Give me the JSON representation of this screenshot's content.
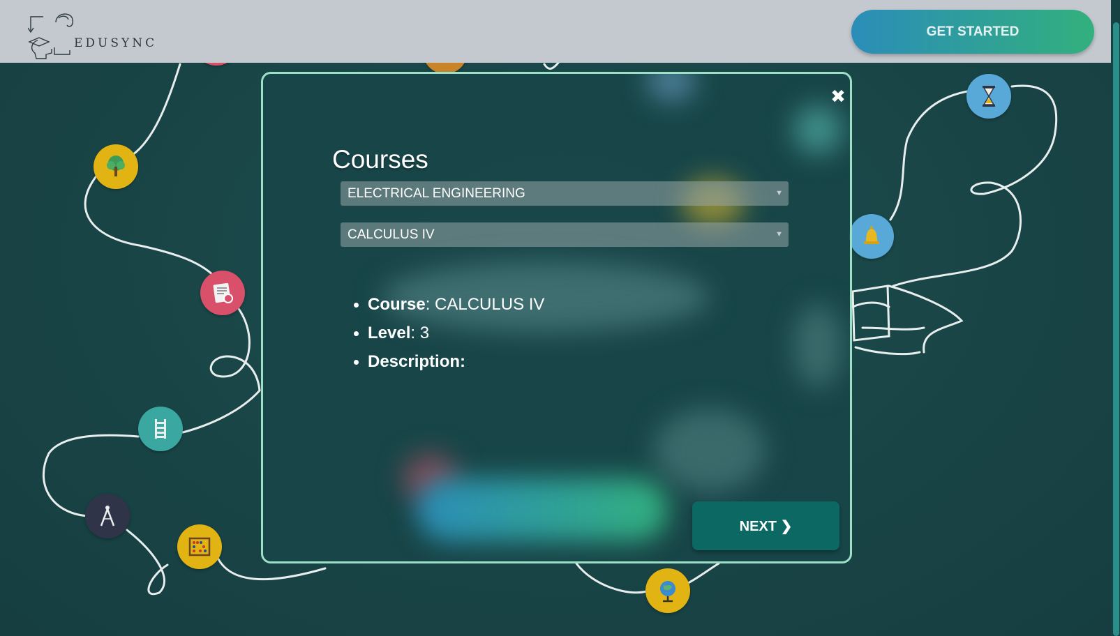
{
  "header": {
    "brand": "EDUSYNC",
    "cta_label": "GET STARTED"
  },
  "modal": {
    "close_label": "✖",
    "title": "Courses",
    "department_select": {
      "selected": "ELECTRICAL ENGINEERING"
    },
    "course_select": {
      "selected": "CALCULUS IV"
    },
    "details": [
      {
        "key": "Course",
        "value": "CALCULUS IV"
      },
      {
        "key": "Level",
        "value": "3"
      },
      {
        "key": "Description",
        "value": ""
      }
    ],
    "next_label": "NEXT ❯"
  },
  "background_icons": [
    {
      "name": "tree-icon",
      "color": "#e1b414"
    },
    {
      "name": "certificate-icon",
      "color": "#d9506a"
    },
    {
      "name": "ladder-icon",
      "color": "#3aa7a0"
    },
    {
      "name": "compass-icon",
      "color": "#2f3448"
    },
    {
      "name": "abacus-icon",
      "color": "#e1b414"
    },
    {
      "name": "globe-icon",
      "color": "#e1b414"
    },
    {
      "name": "hourglass-icon",
      "color": "#58a8d8"
    },
    {
      "name": "bell-icon",
      "color": "#58a8d8"
    }
  ],
  "colors": {
    "background": "#1b4849",
    "header": "#c4c9d0",
    "modal_border": "#9ee0c7",
    "next_button": "#0b6863",
    "cta_gradient_start": "#2b8db8",
    "cta_gradient_end": "#32b07d"
  }
}
